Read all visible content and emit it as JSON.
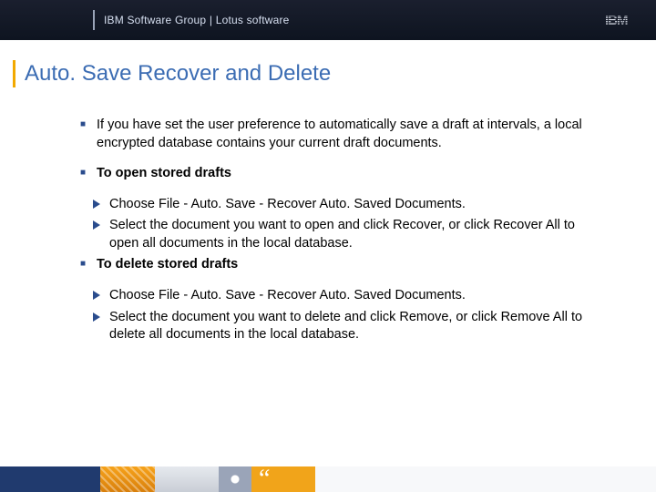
{
  "header": {
    "text": "IBM Software Group | Lotus software",
    "logo_alt": "IBM"
  },
  "title": "Auto. Save Recover and Delete",
  "bullets": {
    "intro": "If you have set the user preference to automatically save a draft at intervals, a local encrypted database contains your current draft documents.",
    "open_heading": "To open stored drafts",
    "open_steps": [
      "Choose File - Auto. Save - Recover Auto. Saved Documents.",
      "Select the document you want to open and click Recover, or click Recover All to open all documents in the local database."
    ],
    "delete_heading": "To delete stored drafts",
    "delete_steps": [
      "Choose File - Auto. Save - Recover Auto. Saved Documents.",
      "Select the document you want to delete and click Remove, or click Remove All to delete all documents in the local database."
    ]
  },
  "footer": {
    "quote_glyph": "“"
  }
}
